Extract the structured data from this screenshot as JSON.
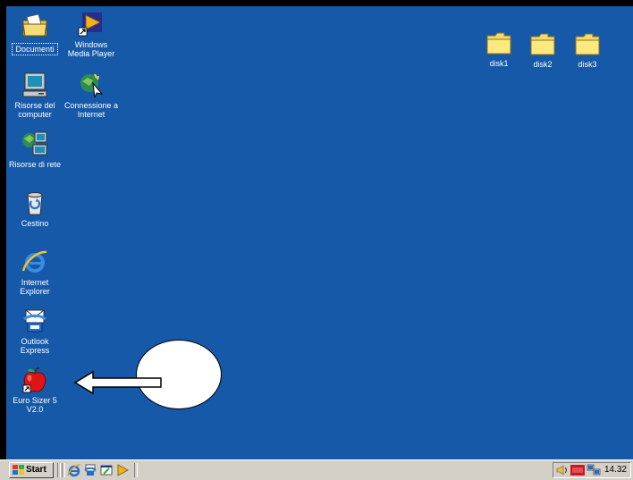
{
  "desktop": {
    "background_color": "#1559A8",
    "left_icons": [
      {
        "label": "Documenti",
        "icon": "documents-folder-icon"
      },
      {
        "label": "Windows\nMedia Player",
        "icon": "media-player-icon"
      },
      {
        "label": "Risorse del\ncomputer",
        "icon": "my-computer-icon"
      },
      {
        "label": "Connessione a\nInternet",
        "icon": "internet-connection-icon"
      },
      {
        "label": "Risorse di rete",
        "icon": "network-icon"
      },
      {
        "label": "Cestino",
        "icon": "recycle-bin-icon"
      },
      {
        "label": "Internet\nExplorer",
        "icon": "internet-explorer-icon"
      },
      {
        "label": "Outlook\nExpress",
        "icon": "outlook-express-icon"
      },
      {
        "label": "Euro Sizer 5\nV2.0",
        "icon": "apple-app-icon"
      }
    ],
    "folders": [
      {
        "label": "disk1",
        "icon": "folder-icon"
      },
      {
        "label": "disk2",
        "icon": "folder-icon"
      },
      {
        "label": "disk3",
        "icon": "folder-icon"
      }
    ]
  },
  "taskbar": {
    "start_label": "Start",
    "quick_launch": [
      "internet-explorer-icon",
      "outlook-express-icon",
      "show-desktop-icon",
      "media-player-icon"
    ],
    "tray_icons": [
      "volume-icon",
      "ati-icon",
      "network-tray-icon"
    ],
    "clock": "14.32"
  }
}
